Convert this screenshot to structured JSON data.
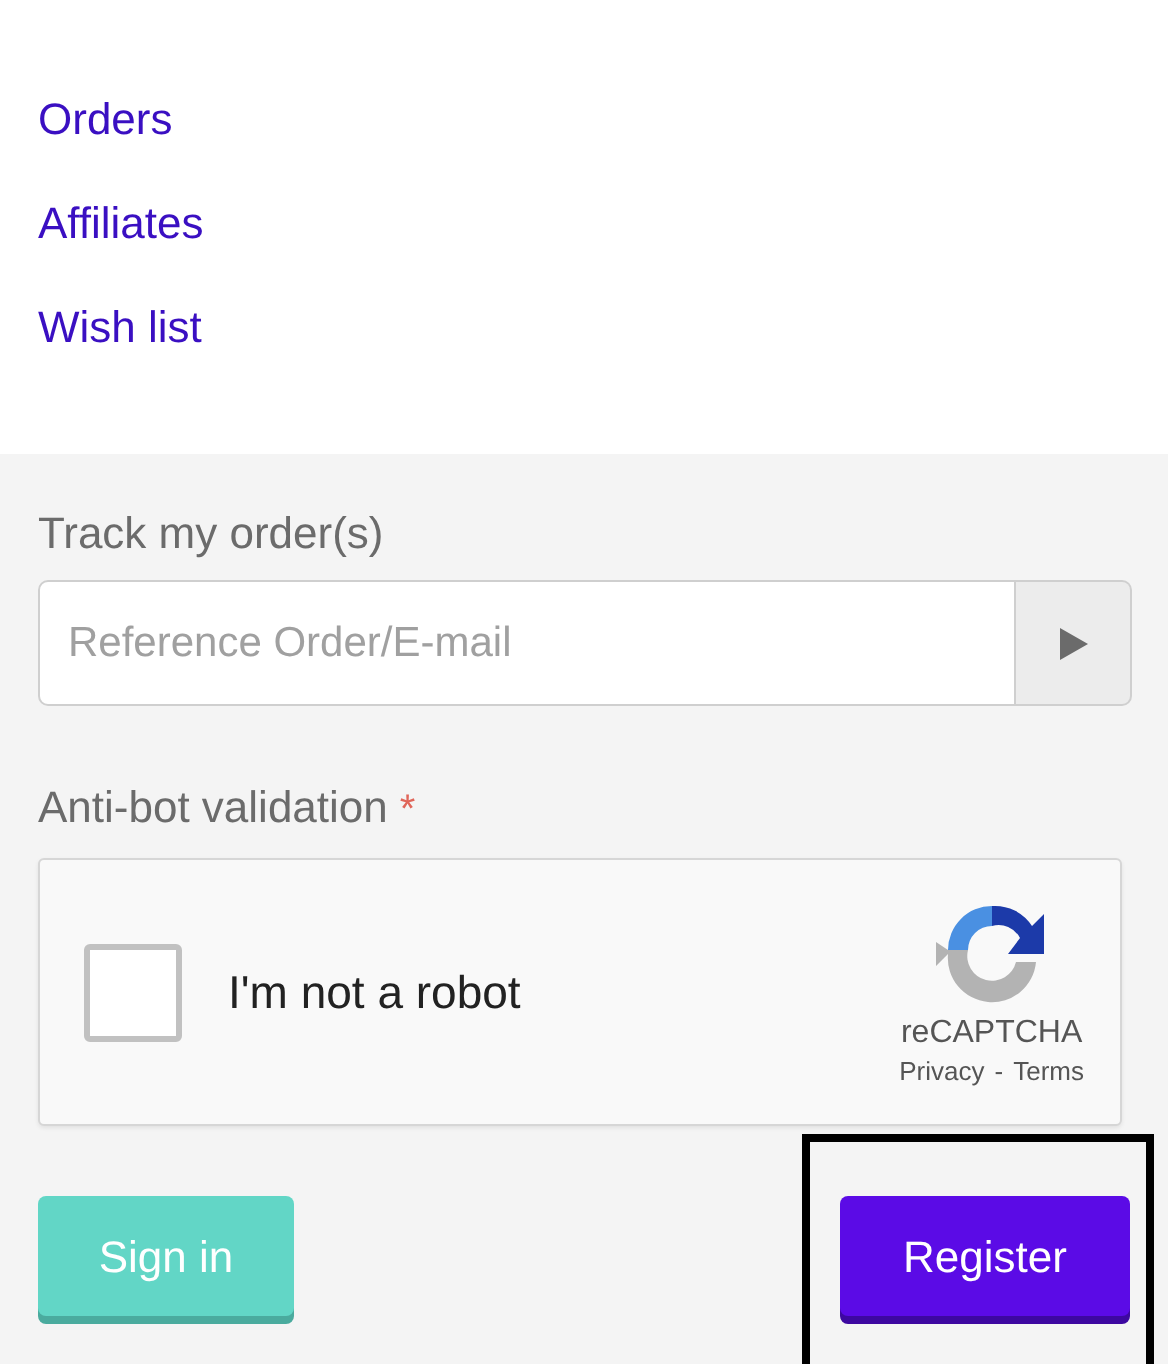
{
  "links": [
    {
      "label": "Orders"
    },
    {
      "label": "Affiliates"
    },
    {
      "label": "Wish list"
    }
  ],
  "track": {
    "label": "Track my order(s)",
    "placeholder": "Reference Order/E-mail"
  },
  "antibot": {
    "label": "Anti-bot validation",
    "required_mark": "*"
  },
  "captcha": {
    "checked": false,
    "label": "I'm not a robot",
    "brand": "reCAPTCHA",
    "privacy": "Privacy",
    "separator": "-",
    "terms": "Terms"
  },
  "buttons": [
    {
      "kind": "secondary",
      "label": "Sign in",
      "highlighted": false
    },
    {
      "kind": "primary",
      "label": "Register",
      "highlighted": true
    }
  ]
}
